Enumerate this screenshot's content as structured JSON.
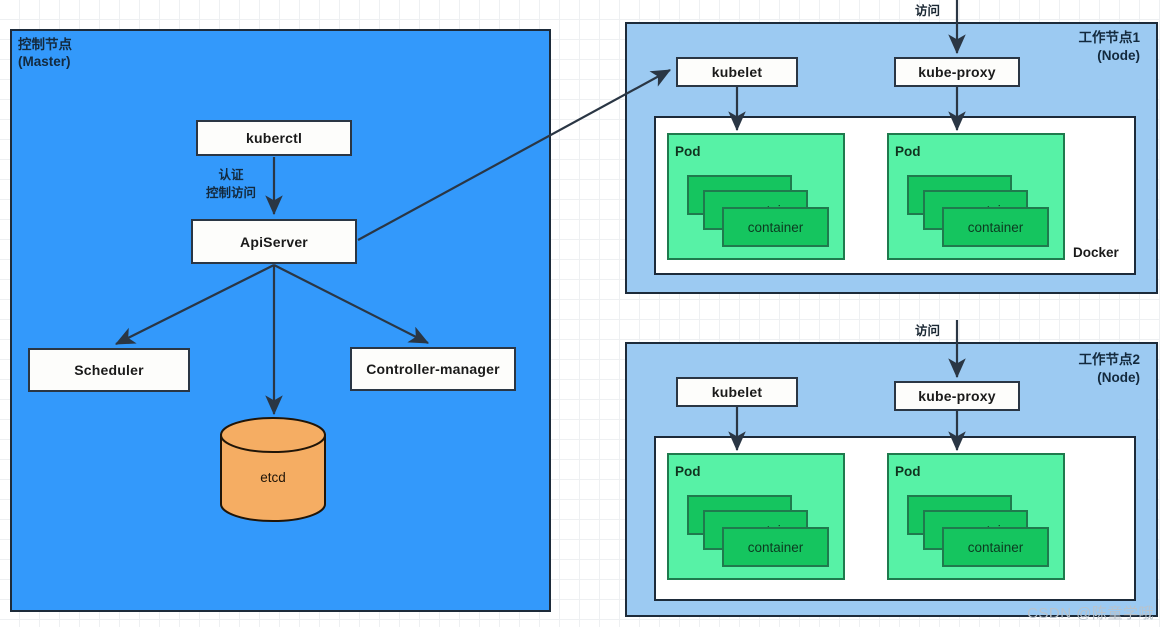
{
  "diagram": {
    "title_watermark": "CSDN @陈童学哦"
  },
  "master": {
    "label_line1": "控制节点",
    "label_line2": "(Master)",
    "boxes": {
      "kuberctl": "kuberctl",
      "apiserver": "ApiServer",
      "scheduler": "Scheduler",
      "controller_manager": "Controller-manager"
    },
    "etcd": "etcd",
    "auth_label_line1": "认证",
    "auth_label_line2": "控制访问"
  },
  "nodes": [
    {
      "label_line1": "工作节点1",
      "label_line2": "(Node)",
      "access_label": "访问",
      "kubelet": "kubelet",
      "kube_proxy": "kube-proxy",
      "runtime_label": "Docker",
      "pods": [
        {
          "title": "Pod",
          "containers": [
            "container",
            "container",
            "container"
          ]
        },
        {
          "title": "Pod",
          "containers": [
            "container",
            "container",
            "container"
          ]
        }
      ]
    },
    {
      "label_line1": "工作节点2",
      "label_line2": "(Node)",
      "access_label": "访问",
      "kubelet": "kubelet",
      "kube_proxy": "kube-proxy",
      "runtime_label": "",
      "pods": [
        {
          "title": "Pod",
          "containers": [
            "container",
            "container",
            "container"
          ]
        },
        {
          "title": "Pod",
          "containers": [
            "container",
            "container",
            "container"
          ]
        }
      ]
    }
  ],
  "colors": {
    "master_panel": "#3399fb",
    "node_panel": "#9ccaf2",
    "pod_fill": "#57f2a6",
    "container_fill": "#15c55f",
    "container_stroke": "#1f7a4d",
    "etcd_fill": "#f5ad63",
    "box_stroke": "#2a3644",
    "arrow": "#2a3644",
    "grid_line": "#eef0f2"
  }
}
